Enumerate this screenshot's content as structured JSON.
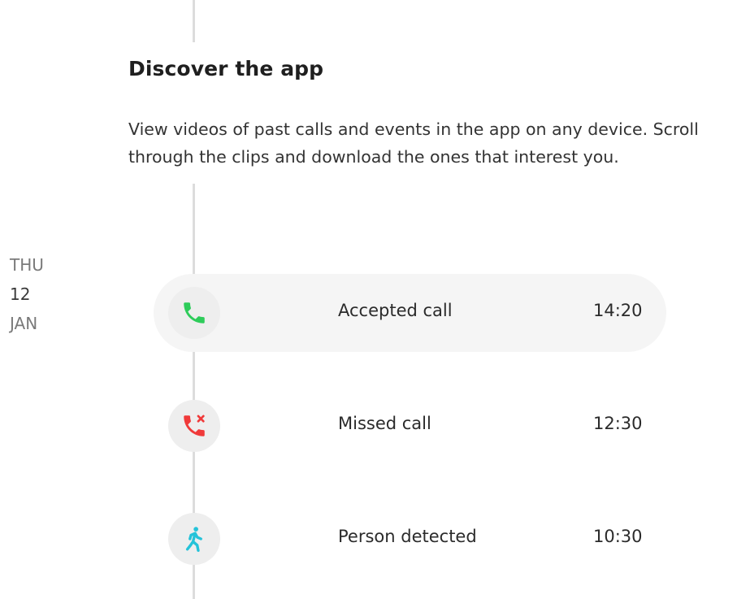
{
  "section": {
    "title": "Discover the app",
    "description_line1": "View videos of past calls and events in the app on any device. Scroll",
    "description_line2": "through the clips and download the ones that interest you."
  },
  "date": {
    "weekday": "THU",
    "day": "12",
    "month": "JAN"
  },
  "events": [
    {
      "label": "Accepted call",
      "time": "14:20",
      "icon": "phone-accepted-icon",
      "color": "#2ecc5a",
      "selected": true
    },
    {
      "label": "Missed call",
      "time": "12:30",
      "icon": "phone-missed-icon",
      "color": "#f03a3a",
      "selected": false
    },
    {
      "label": "Person detected",
      "time": "10:30",
      "icon": "person-walking-icon",
      "color": "#25c3d9",
      "selected": false
    }
  ]
}
